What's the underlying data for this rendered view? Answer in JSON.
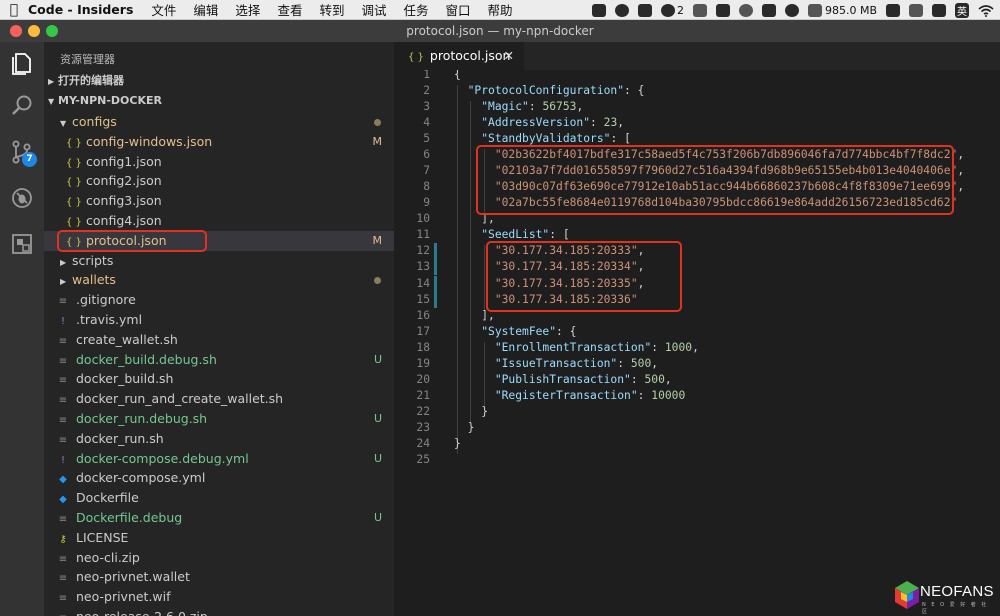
{
  "menubar": {
    "app_name": "Code - Insiders",
    "menus": [
      "文件",
      "编辑",
      "选择",
      "查看",
      "转到",
      "调试",
      "任务",
      "窗口",
      "帮助"
    ],
    "tray_badge": "2",
    "memory": "985.0 MB",
    "ime": "英"
  },
  "window": {
    "title": "protocol.json — my-npn-docker"
  },
  "activity": {
    "scm_badge": "7"
  },
  "sidebar": {
    "title": "资源管理器",
    "open_editors": "打开的编辑器",
    "project": "MY-NPN-DOCKER",
    "items": [
      {
        "name": "configs",
        "kind": "folder",
        "status": "dot",
        "color": "mod"
      },
      {
        "name": "config-windows.json",
        "kind": "json",
        "status": "M",
        "color": "mod"
      },
      {
        "name": "config1.json",
        "kind": "json",
        "status": "",
        "color": "norm"
      },
      {
        "name": "config2.json",
        "kind": "json",
        "status": "",
        "color": "norm"
      },
      {
        "name": "config3.json",
        "kind": "json",
        "status": "",
        "color": "norm"
      },
      {
        "name": "config4.json",
        "kind": "json",
        "status": "",
        "color": "norm"
      },
      {
        "name": "protocol.json",
        "kind": "json",
        "status": "M",
        "color": "mod"
      },
      {
        "name": "scripts",
        "kind": "folder",
        "status": "",
        "color": "norm"
      },
      {
        "name": "wallets",
        "kind": "folder",
        "status": "dot",
        "color": "mod"
      },
      {
        "name": ".gitignore",
        "kind": "file",
        "status": "",
        "color": "norm"
      },
      {
        "name": ".travis.yml",
        "kind": "yml",
        "status": "",
        "color": "norm"
      },
      {
        "name": "create_wallet.sh",
        "kind": "file",
        "status": "",
        "color": "norm"
      },
      {
        "name": "docker_build.debug.sh",
        "kind": "file",
        "status": "U",
        "color": "untr"
      },
      {
        "name": "docker_build.sh",
        "kind": "file",
        "status": "",
        "color": "norm"
      },
      {
        "name": "docker_run_and_create_wallet.sh",
        "kind": "file",
        "status": "",
        "color": "norm"
      },
      {
        "name": "docker_run.debug.sh",
        "kind": "file",
        "status": "U",
        "color": "untr"
      },
      {
        "name": "docker_run.sh",
        "kind": "file",
        "status": "",
        "color": "norm"
      },
      {
        "name": "docker-compose.debug.yml",
        "kind": "yml",
        "status": "U",
        "color": "untr"
      },
      {
        "name": "docker-compose.yml",
        "kind": "docker",
        "status": "",
        "color": "norm"
      },
      {
        "name": "Dockerfile",
        "kind": "docker",
        "status": "",
        "color": "norm"
      },
      {
        "name": "Dockerfile.debug",
        "kind": "file",
        "status": "U",
        "color": "untr"
      },
      {
        "name": "LICENSE",
        "kind": "license",
        "status": "",
        "color": "norm"
      },
      {
        "name": "neo-cli.zip",
        "kind": "file",
        "status": "",
        "color": "norm"
      },
      {
        "name": "neo-privnet.wallet",
        "kind": "file",
        "status": "",
        "color": "norm"
      },
      {
        "name": "neo-privnet.wif",
        "kind": "file",
        "status": "",
        "color": "norm"
      },
      {
        "name": "neo-release-2.6.0.zip",
        "kind": "file",
        "status": "",
        "color": "norm"
      }
    ]
  },
  "editor": {
    "tab_label": "protocol.json",
    "tab_close": "✕",
    "line_numbers": [
      "1",
      "2",
      "3",
      "4",
      "5",
      "6",
      "7",
      "8",
      "9",
      "10",
      "11",
      "12",
      "13",
      "14",
      "15",
      "16",
      "17",
      "18",
      "19",
      "20",
      "21",
      "22",
      "23",
      "24",
      "25"
    ],
    "lines": [
      "{",
      "  \"ProtocolConfiguration\": {",
      "    \"Magic\": 56753,",
      "    \"AddressVersion\": 23,",
      "    \"StandbyValidators\": [",
      "      \"02b3622bf4017bdfe317c58aed5f4c753f206b7db896046fa7d774bbc4bf7f8dc2\",",
      "      \"02103a7f7dd016558597f7960d27c516a4394fd968b9e65155eb4b013e4040406e\",",
      "      \"03d90c07df63e690ce77912e10ab51acc944b66860237b608c4f8f8309e71ee699\",",
      "      \"02a7bc55fe8684e0119768d104ba30795bdcc86619e864add26156723ed185cd62\"",
      "    ],",
      "    \"SeedList\": [",
      "      \"30.177.34.185:20333\",",
      "      \"30.177.34.185:20334\",",
      "      \"30.177.34.185:20335\",",
      "      \"30.177.34.185:20336\"",
      "    ],",
      "    \"SystemFee\": {",
      "      \"EnrollmentTransaction\": 1000,",
      "      \"IssueTransaction\": 500,",
      "      \"PublishTransaction\": 500,",
      "      \"RegisterTransaction\": 10000",
      "    }",
      "  }",
      "}",
      ""
    ]
  },
  "watermark": {
    "text": "NEOFANS",
    "subtext": "N E O 爱 好 者 社 区"
  },
  "colors": {
    "accent_red": "#e0321f",
    "modified": "#e2c08d",
    "untracked": "#73c991",
    "json_key": "#9cdcfe",
    "json_string": "#ce9178",
    "json_number": "#b5cea8"
  }
}
